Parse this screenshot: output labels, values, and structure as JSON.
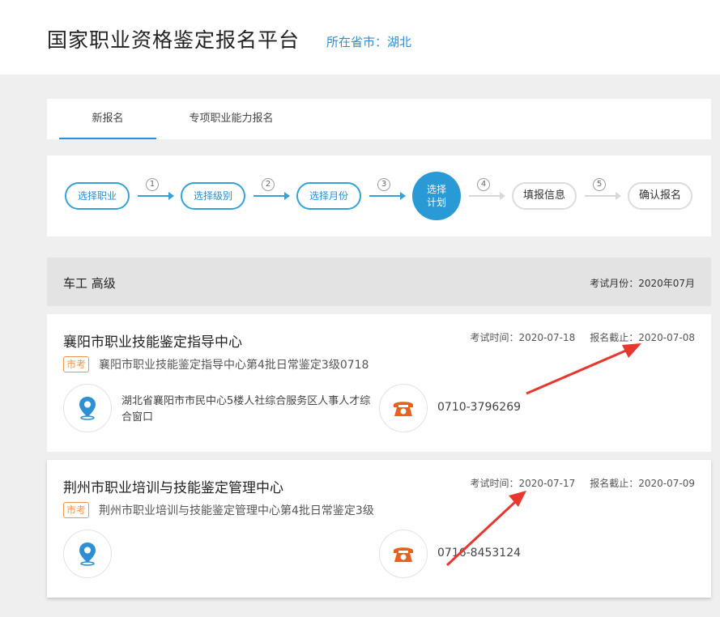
{
  "header": {
    "title": "国家职业资格鉴定报名平台",
    "province": "所在省市：湖北"
  },
  "tabs": [
    {
      "label": "新报名",
      "active": true
    },
    {
      "label": "专项职业能力报名",
      "active": false
    }
  ],
  "steps": {
    "items": [
      "选择职业",
      "选择级别",
      "选择月份",
      "选择计划",
      "填报信息",
      "确认报名"
    ],
    "numbers": [
      "1",
      "2",
      "3",
      "4",
      "5"
    ],
    "current": 4
  },
  "job": {
    "name": "车工 高级",
    "exam_month": "考试月份：2020年07月"
  },
  "cards": [
    {
      "title": "襄阳市职业技能鉴定指导中心",
      "exam_time": "考试时间：2020-07-18",
      "deadline": "报名截止：2020-07-08",
      "badge": "市考",
      "subtitle": "襄阳市职业技能鉴定指导中心第4批日常鉴定3级0718",
      "address": "湖北省襄阳市市民中心5楼人社综合服务区人事人才综合窗口",
      "phone": "0710-3796269",
      "location_icon": "location-pin-icon",
      "phone_icon": "telephone-icon"
    },
    {
      "title": "荆州市职业培训与技能鉴定管理中心",
      "exam_time": "考试时间：2020-07-17",
      "deadline": "报名截止：2020-07-09",
      "badge": "市考",
      "subtitle": "荆州市职业培训与技能鉴定管理中心第4批日常鉴定3级",
      "address": "",
      "phone": "0716-8453124",
      "location_icon": "location-pin-icon",
      "phone_icon": "telephone-icon"
    }
  ],
  "colors": {
    "accent": "#2d8fd5",
    "badge": "#f19449",
    "phone_icon": "#e8601c",
    "annotation_arrow": "#e8382e"
  }
}
